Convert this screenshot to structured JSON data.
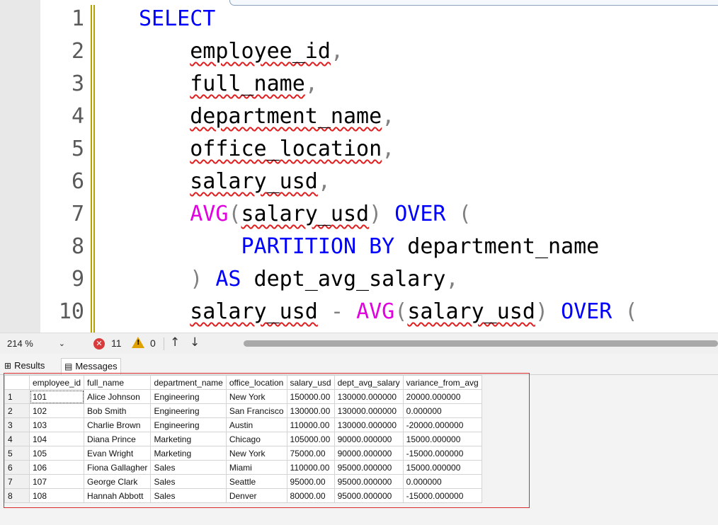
{
  "editor": {
    "line_numbers": [
      "1",
      "2",
      "3",
      "4",
      "5",
      "6",
      "7",
      "8",
      "9",
      "10"
    ],
    "lines": [
      [
        {
          "t": "SELECT",
          "c": "kw"
        }
      ],
      [
        {
          "t": "    "
        },
        {
          "t": "employee_id",
          "s": true
        },
        {
          "t": ",",
          "c": "gr"
        }
      ],
      [
        {
          "t": "    "
        },
        {
          "t": "full_name",
          "s": true
        },
        {
          "t": ",",
          "c": "gr"
        }
      ],
      [
        {
          "t": "    "
        },
        {
          "t": "department_name",
          "s": true
        },
        {
          "t": ",",
          "c": "gr"
        }
      ],
      [
        {
          "t": "    "
        },
        {
          "t": "office_location",
          "s": true
        },
        {
          "t": ",",
          "c": "gr"
        }
      ],
      [
        {
          "t": "    "
        },
        {
          "t": "salary_usd",
          "s": true
        },
        {
          "t": ",",
          "c": "gr"
        }
      ],
      [
        {
          "t": "    "
        },
        {
          "t": "AVG",
          "c": "fn"
        },
        {
          "t": "(",
          "c": "gr"
        },
        {
          "t": "salary_usd",
          "s": true
        },
        {
          "t": ")",
          "c": "gr"
        },
        {
          "t": " "
        },
        {
          "t": "OVER",
          "c": "kw"
        },
        {
          "t": " "
        },
        {
          "t": "(",
          "c": "gr"
        }
      ],
      [
        {
          "t": "        "
        },
        {
          "t": "PARTITION",
          "c": "kw"
        },
        {
          "t": " "
        },
        {
          "t": "BY",
          "c": "kw"
        },
        {
          "t": " department_name"
        }
      ],
      [
        {
          "t": "    "
        },
        {
          "t": ")",
          "c": "gr"
        },
        {
          "t": " "
        },
        {
          "t": "AS",
          "c": "kw"
        },
        {
          "t": " dept_avg_salary"
        },
        {
          "t": ",",
          "c": "gr"
        }
      ],
      [
        {
          "t": "    "
        },
        {
          "t": "salary_usd",
          "s": true
        },
        {
          "t": " "
        },
        {
          "t": "-",
          "c": "gr"
        },
        {
          "t": " "
        },
        {
          "t": "AVG",
          "c": "fn"
        },
        {
          "t": "(",
          "c": "gr"
        },
        {
          "t": "salary_usd",
          "s": true
        },
        {
          "t": ")",
          "c": "gr"
        },
        {
          "t": " "
        },
        {
          "t": "OVER",
          "c": "kw"
        },
        {
          "t": " "
        },
        {
          "t": "(",
          "c": "gr"
        }
      ]
    ]
  },
  "statusbar": {
    "zoom": "214 %",
    "error_count": "11",
    "warning_count": "0",
    "error_icon_glyph": "✕",
    "up_arrow": "↑",
    "down_arrow": "↓",
    "zoom_caret": "⌄"
  },
  "tabs": {
    "results_label": "Results",
    "messages_label": "Messages",
    "results_icon": "⊞",
    "messages_icon": "▤"
  },
  "grid": {
    "columns": [
      "employee_id",
      "full_name",
      "department_name",
      "office_location",
      "salary_usd",
      "dept_avg_salary",
      "variance_from_avg"
    ],
    "rows": [
      [
        "1",
        "101",
        "Alice Johnson",
        "Engineering",
        "New York",
        "150000.00",
        "130000.000000",
        "20000.000000"
      ],
      [
        "2",
        "102",
        "Bob Smith",
        "Engineering",
        "San Francisco",
        "130000.00",
        "130000.000000",
        "0.000000"
      ],
      [
        "3",
        "103",
        "Charlie Brown",
        "Engineering",
        "Austin",
        "110000.00",
        "130000.000000",
        "-20000.000000"
      ],
      [
        "4",
        "104",
        "Diana Prince",
        "Marketing",
        "Chicago",
        "105000.00",
        "90000.000000",
        "15000.000000"
      ],
      [
        "5",
        "105",
        "Evan Wright",
        "Marketing",
        "New York",
        "75000.00",
        "90000.000000",
        "-15000.000000"
      ],
      [
        "6",
        "106",
        "Fiona Gallagher",
        "Sales",
        "Miami",
        "110000.00",
        "95000.000000",
        "15000.000000"
      ],
      [
        "7",
        "107",
        "George Clark",
        "Sales",
        "Seattle",
        "95000.00",
        "95000.000000",
        "0.000000"
      ],
      [
        "8",
        "108",
        "Hannah Abbott",
        "Sales",
        "Denver",
        "80000.00",
        "95000.000000",
        "-15000.000000"
      ]
    ]
  },
  "colors": {
    "keyword": "#0000ff",
    "function": "#e000e0",
    "squiggle": "#e02020",
    "highlight_box": "#d92b2b"
  }
}
